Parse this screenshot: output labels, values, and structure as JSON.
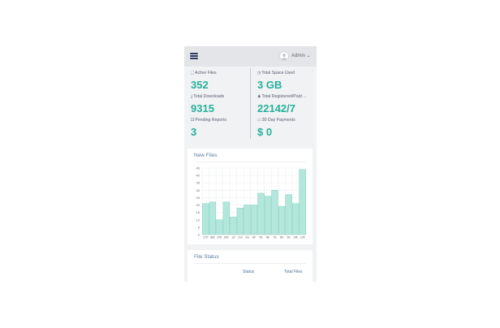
{
  "header": {
    "admin_label": "Admin ⌄"
  },
  "stats": [
    {
      "icon": "🗋",
      "label": "Active Files",
      "value": "352"
    },
    {
      "icon": "◷",
      "label": "Total Space Used",
      "value": "3 GB"
    },
    {
      "icon": "⤓",
      "label": "Total Downloads",
      "value": "9315"
    },
    {
      "icon": "♟",
      "label": "Total Registered/Paid ...",
      "value": "22142/7"
    },
    {
      "icon": "⚀",
      "label": "Pending Reports",
      "value": "3"
    },
    {
      "icon": "▭",
      "label": "30 Day Payments",
      "value": "$ 0"
    }
  ],
  "new_files": {
    "title": "New Files",
    "chart_data": {
      "type": "bar",
      "categories": [
        "27th",
        "28th",
        "29th",
        "30th",
        "1st",
        "2nd",
        "3rd",
        "4th",
        "5th",
        "6th",
        "7th",
        "8th",
        "9th",
        "10th",
        "11th"
      ],
      "values": [
        21,
        22,
        10,
        22,
        12,
        18,
        20,
        20,
        28,
        26,
        30,
        19,
        27,
        21,
        44
      ],
      "ylim": [
        0,
        45
      ],
      "yticks": [
        0,
        5,
        10,
        15,
        20,
        25,
        30,
        35,
        40,
        45
      ],
      "bar_fill": "#b3e7dc",
      "bar_stroke": "#7fd1bf",
      "grid": true
    }
  },
  "file_status": {
    "title": "File Status",
    "col_status": "Status",
    "col_total": "Total Files"
  }
}
